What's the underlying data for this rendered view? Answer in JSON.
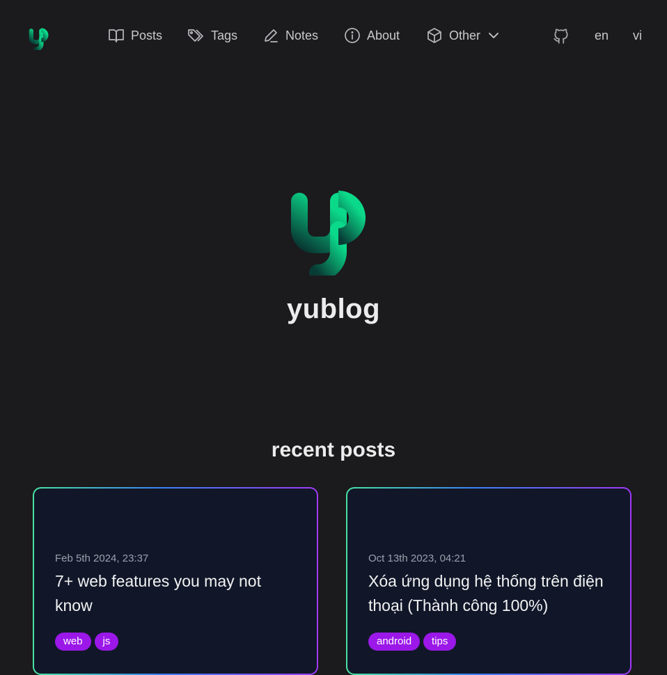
{
  "nav": {
    "items": [
      {
        "label": "Posts",
        "icon": "book-icon"
      },
      {
        "label": "Tags",
        "icon": "tags-icon"
      },
      {
        "label": "Notes",
        "icon": "pencil-icon"
      },
      {
        "label": "About",
        "icon": "info-icon"
      },
      {
        "label": "Other",
        "icon": "cube-icon"
      }
    ],
    "github_icon": "github-icon",
    "languages": [
      "en",
      "vi"
    ]
  },
  "hero": {
    "site_name": "yublog"
  },
  "recent": {
    "heading": "recent posts",
    "posts": [
      {
        "date": "Feb 5th 2024, 23:37",
        "title": "7+ web features you may not know",
        "tags": [
          "web",
          "js"
        ]
      },
      {
        "date": "Oct 13th 2023, 04:21",
        "title": "Xóa ứng dụng hệ thống trên điện thoại (Thành công 100%)",
        "tags": [
          "android",
          "tips"
        ]
      }
    ]
  },
  "colors": {
    "background": "#1b1a1c",
    "card_background": "#111729",
    "tag_background": "#9b18e8",
    "logo_green": "#0bd98a",
    "card_border_gradient": [
      "#49e3a1",
      "#3b82f6",
      "#a03af5"
    ]
  }
}
